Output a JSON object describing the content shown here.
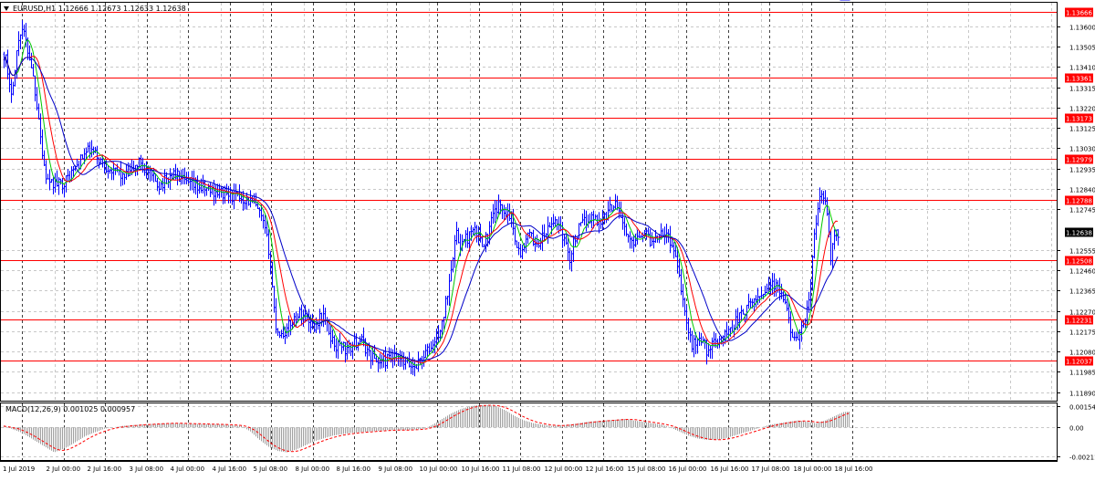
{
  "window": {
    "symbol_info": "EURUSD,H1  1.12666 1.12673 1.12633 1.12638",
    "menu_arrow": "triangle-down-icon"
  },
  "colors": {
    "background": "#ffffff",
    "grid": "#c8c8c8",
    "price_bars": "#0000ff",
    "ma_fast": "#00c800",
    "ma_mid": "#ff0000",
    "ma_slow": "#0000c8",
    "level_line": "#ff0000",
    "level_tag_bg": "#ff0000",
    "level_tag_text": "#ffffff",
    "current_tag_bg": "#000000",
    "histogram": "#a0a0a0",
    "signal": "#ff0000"
  },
  "chart_data": [
    {
      "type": "candlestick",
      "title": "",
      "ylim": [
        1.1185,
        1.1371
      ],
      "grid": true,
      "y_ticks": [
        "1.13600",
        "1.13505",
        "1.13410",
        "1.13315",
        "1.13220",
        "1.13125",
        "1.13030",
        "1.12935",
        "1.12840",
        "1.12745",
        "1.12555",
        "1.12460",
        "1.12365",
        "1.12270",
        "1.12175",
        "1.12080",
        "1.11985",
        "1.11890"
      ],
      "x_ticks": [
        "1 Jul 2019",
        "2 Jul 00:00",
        "2 Jul 16:00",
        "3 Jul 08:00",
        "4 Jul 00:00",
        "4 Jul 16:00",
        "5 Jul 08:00",
        "8 Jul 00:00",
        "8 Jul 16:00",
        "9 Jul 08:00",
        "10 Jul 00:00",
        "10 Jul 16:00",
        "11 Jul 08:00",
        "12 Jul 00:00",
        "12 Jul 16:00",
        "15 Jul 08:00",
        "16 Jul 00:00",
        "16 Jul 16:00",
        "17 Jul 08:00",
        "18 Jul 00:00",
        "18 Jul 16:00"
      ],
      "horizontal_levels": [
        {
          "value": 1.13666,
          "label": "1.13666"
        },
        {
          "value": 1.13361,
          "label": "1.13361"
        },
        {
          "value": 1.13173,
          "label": "1.13173"
        },
        {
          "value": 1.12979,
          "label": "1.12979"
        },
        {
          "value": 1.12788,
          "label": "1.12788"
        },
        {
          "value": 1.12508,
          "label": "1.12508"
        },
        {
          "value": 1.12231,
          "label": "1.12231"
        },
        {
          "value": 1.12037,
          "label": "1.12037"
        }
      ],
      "current_price": {
        "value": 1.12638,
        "label": "1.12638"
      },
      "price_path": {
        "x": [
          0,
          2,
          4,
          7,
          10,
          12,
          15,
          19,
          22,
          26,
          30,
          34,
          38,
          42,
          46,
          50,
          55,
          60,
          68,
          75,
          82,
          88,
          94,
          100,
          106,
          110,
          115,
          120,
          125,
          130,
          135,
          140,
          145,
          150,
          155,
          160,
          165,
          170,
          175,
          180,
          185,
          190,
          195,
          200,
          210,
          220,
          230,
          240,
          250,
          260,
          270,
          275,
          280,
          285,
          290,
          292,
          294,
          296,
          298,
          300,
          304,
          310,
          315,
          320,
          325,
          330,
          335,
          340,
          345,
          350,
          355,
          360,
          365,
          370,
          375,
          380,
          390,
          400,
          410,
          420,
          430,
          440,
          450,
          460,
          470,
          480,
          485,
          488,
          490,
          492,
          494,
          496,
          498,
          500,
          505,
          510,
          515,
          520,
          525,
          530,
          535,
          540,
          545,
          550,
          555,
          558,
          560,
          563,
          566,
          570,
          575,
          580,
          585,
          590,
          595,
          600,
          605,
          610,
          615,
          620,
          625,
          630,
          635,
          640,
          645,
          650,
          655,
          660,
          665,
          670,
          675,
          680,
          685,
          690,
          695,
          700,
          705,
          710,
          715,
          720,
          725,
          730,
          735,
          740,
          742,
          745,
          748,
          750,
          752,
          755,
          758,
          760,
          765,
          770,
          775,
          780,
          785,
          790,
          795,
          800,
          805,
          810,
          815,
          820,
          825,
          830,
          835,
          840,
          845,
          850,
          855,
          860,
          865,
          870,
          875,
          880,
          882,
          884,
          886,
          888,
          892,
          896,
          900,
          904,
          906,
          908,
          910,
          912,
          914,
          916,
          918,
          920,
          925,
          930
        ],
        "y": [
          1.1347,
          1.1345,
          1.1336,
          1.1328,
          1.1335,
          1.1339,
          1.1352,
          1.136,
          1.1356,
          1.1349,
          1.1342,
          1.133,
          1.1318,
          1.13,
          1.129,
          1.1285,
          1.1287,
          1.1286,
          1.1288,
          1.1292,
          1.1296,
          1.13,
          1.1302,
          1.13,
          1.1297,
          1.1294,
          1.1295,
          1.1291,
          1.1293,
          1.1289,
          1.129,
          1.1292,
          1.1295,
          1.1297,
          1.1293,
          1.129,
          1.1288,
          1.1286,
          1.1287,
          1.1289,
          1.1291,
          1.129,
          1.1288,
          1.1286,
          1.1285,
          1.1284,
          1.1283,
          1.1282,
          1.1281,
          1.128,
          1.1278,
          1.1276,
          1.1272,
          1.1266,
          1.1256,
          1.1248,
          1.1238,
          1.1228,
          1.122,
          1.1218,
          1.1216,
          1.1218,
          1.1222,
          1.1224,
          1.1226,
          1.1225,
          1.1222,
          1.122,
          1.1223,
          1.1225,
          1.1218,
          1.1213,
          1.121,
          1.1212,
          1.1208,
          1.121,
          1.1214,
          1.1207,
          1.1203,
          1.1204,
          1.1205,
          1.1202,
          1.1201,
          1.1206,
          1.1211,
          1.122,
          1.1233,
          1.1242,
          1.1249,
          1.1254,
          1.1259,
          1.1262,
          1.126,
          1.1258,
          1.126,
          1.1262,
          1.1264,
          1.1262,
          1.1259,
          1.1262,
          1.127,
          1.1275,
          1.1276,
          1.1274,
          1.1272,
          1.1266,
          1.1262,
          1.1257,
          1.1252,
          1.1258,
          1.1262,
          1.126,
          1.1258,
          1.1261,
          1.1264,
          1.1267,
          1.127,
          1.1265,
          1.1258,
          1.1252,
          1.126,
          1.1265,
          1.1268,
          1.127,
          1.1271,
          1.1269,
          1.127,
          1.1272,
          1.1275,
          1.1279,
          1.1273,
          1.1265,
          1.1259,
          1.126,
          1.1263,
          1.1264,
          1.1262,
          1.1259,
          1.1262,
          1.1265,
          1.1263,
          1.126,
          1.1254,
          1.1246,
          1.1238,
          1.1229,
          1.1222,
          1.1217,
          1.1213,
          1.1211,
          1.1212,
          1.1215,
          1.1213,
          1.1209,
          1.121,
          1.1212,
          1.1214,
          1.1216,
          1.1218,
          1.1221,
          1.1224,
          1.1226,
          1.1228,
          1.1231,
          1.1233,
          1.1235,
          1.1238,
          1.124,
          1.1238,
          1.1236,
          1.1231,
          1.1222,
          1.1216,
          1.1211,
          1.1219,
          1.1227,
          1.1233,
          1.124,
          1.125,
          1.1262,
          1.1275,
          1.1282,
          1.1278,
          1.1262,
          1.1252,
          1.1256,
          1.1262,
          1.1263,
          1.1264
        ]
      },
      "moving_averages": [
        {
          "key": "ma_fast",
          "lag": 6
        },
        {
          "key": "ma_mid",
          "lag": 12
        },
        {
          "key": "ma_slow",
          "lag": 22
        }
      ]
    },
    {
      "type": "bar",
      "title": "MACD(12,26,9) 0.001025 0.000957",
      "ylim": [
        -0.00235,
        0.00172
      ],
      "y_ticks": [
        {
          "value": 0.001544,
          "label": "0.001544"
        },
        {
          "value": 0.0,
          "label": "0.00"
        },
        {
          "value": -0.002114,
          "label": "-0.002114"
        }
      ],
      "histogram_path": {
        "x": [
          0,
          20,
          40,
          55,
          70,
          90,
          110,
          130,
          150,
          180,
          210,
          240,
          260,
          270,
          280,
          290,
          300,
          310,
          320,
          330,
          340,
          350,
          360,
          380,
          400,
          420,
          440,
          460,
          470,
          480,
          490,
          500,
          510,
          520,
          530,
          540,
          550,
          560,
          570,
          580,
          590,
          600,
          620,
          640,
          660,
          680,
          700,
          720,
          730,
          740,
          750,
          760,
          770,
          780,
          790,
          800,
          810,
          820,
          830,
          840,
          850,
          860,
          870,
          880,
          890,
          900,
          910,
          920,
          930
        ],
        "y": [
          0.0001,
          -0.0004,
          -0.0012,
          -0.0018,
          -0.0014,
          -0.0006,
          -0.0001,
          0.0001,
          0.0002,
          0.0003,
          0.00025,
          0.0002,
          0.0001,
          -0.0003,
          -0.0009,
          -0.0014,
          -0.0017,
          -0.0018,
          -0.0016,
          -0.0013,
          -0.001,
          -0.0008,
          -0.0006,
          -0.0004,
          -0.0003,
          -0.0002,
          -0.0002,
          -0.0001,
          0.0002,
          0.0006,
          0.001,
          0.0013,
          0.0015,
          0.0016,
          0.0016,
          0.0015,
          0.0012,
          0.0008,
          0.0005,
          0.0003,
          0.0002,
          0.0001,
          0.0002,
          0.0004,
          0.0005,
          0.0006,
          0.0004,
          0.0002,
          0.0,
          -0.0003,
          -0.0006,
          -0.0008,
          -0.0009,
          -0.0009,
          -0.0008,
          -0.0006,
          -0.0004,
          -0.0002,
          0.0,
          0.0002,
          0.0003,
          0.0004,
          0.0005,
          0.0004,
          0.0003,
          0.0005,
          0.0008,
          0.0011,
          0.00115
        ]
      },
      "signal_lag": 8
    }
  ]
}
